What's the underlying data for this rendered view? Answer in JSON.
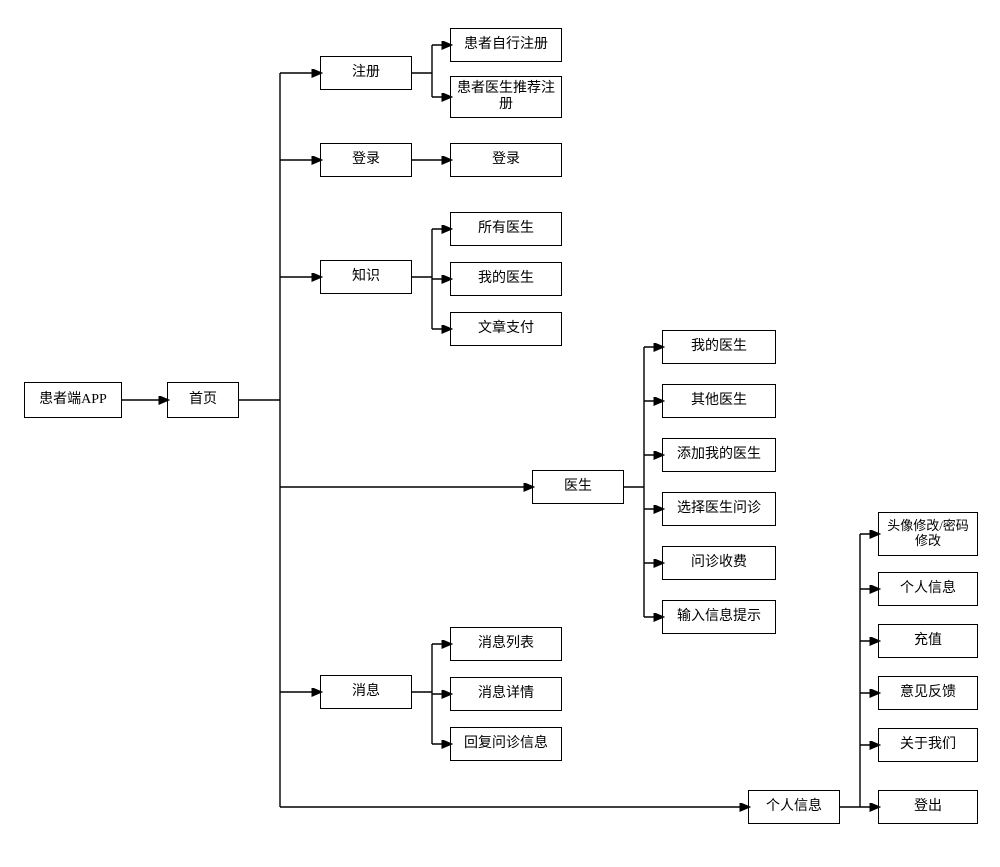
{
  "chart_data": {
    "type": "tree",
    "root": "患者端APP",
    "children": [
      {
        "name": "首页",
        "children": [
          {
            "name": "注册",
            "children": [
              "患者自行注册",
              "患者医生推荐注册"
            ]
          },
          {
            "name": "登录",
            "children": [
              "登录"
            ]
          },
          {
            "name": "知识",
            "children": [
              "所有医生",
              "我的医生",
              "文章支付"
            ]
          },
          {
            "name": "医生",
            "children": [
              "我的医生",
              "其他医生",
              "添加我的医生",
              "选择医生问诊",
              "问诊收费",
              "输入信息提示"
            ]
          },
          {
            "name": "消息",
            "children": [
              "消息列表",
              "消息详情",
              "回复问诊信息"
            ]
          },
          {
            "name": "个人信息",
            "children": [
              "头像修改/密码修改",
              "个人信息",
              "充值",
              "意见反馈",
              "关于我们",
              "登出"
            ]
          }
        ]
      }
    ]
  },
  "root": {
    "label": "患者端APP"
  },
  "home": {
    "label": "首页"
  },
  "register": {
    "label": "注册",
    "items": [
      "患者自行注册",
      "患者医生推荐注册"
    ]
  },
  "login": {
    "label": "登录",
    "items": [
      "登录"
    ]
  },
  "knowledge": {
    "label": "知识",
    "items": [
      "所有医生",
      "我的医生",
      "文章支付"
    ]
  },
  "doctor": {
    "label": "医生",
    "items": [
      "我的医生",
      "其他医生",
      "添加我的医生",
      "选择医生问诊",
      "问诊收费",
      "输入信息提示"
    ]
  },
  "message": {
    "label": "消息",
    "items": [
      "消息列表",
      "消息详情",
      "回复问诊信息"
    ]
  },
  "profile": {
    "label": "个人信息",
    "items": [
      "头像修改/密码修改",
      "个人信息",
      "充值",
      "意见反馈",
      "关于我们",
      "登出"
    ]
  }
}
